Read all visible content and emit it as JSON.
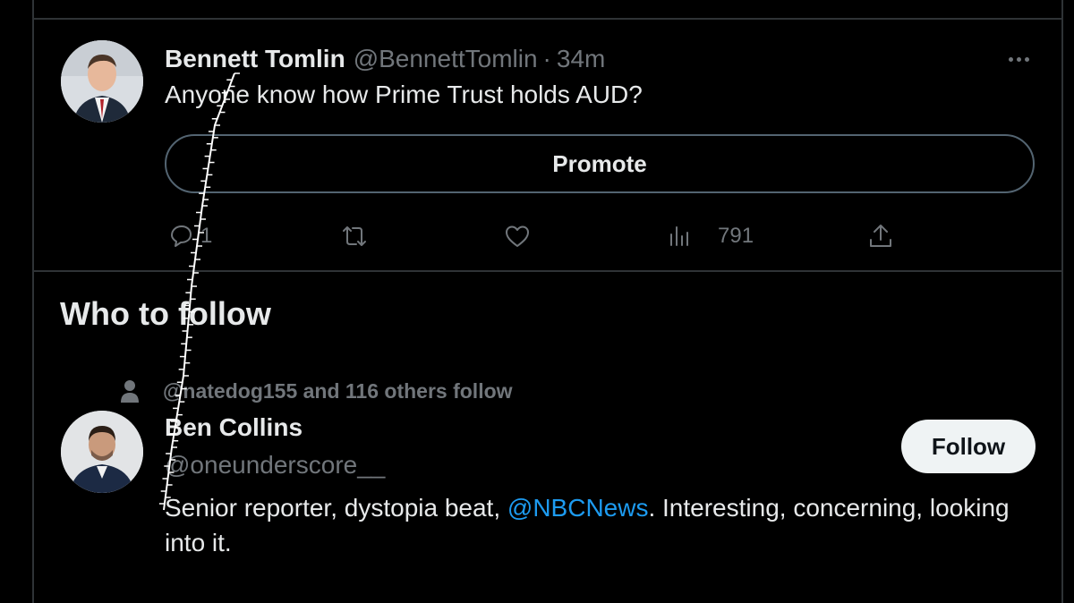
{
  "tweet": {
    "display_name": "Bennett Tomlin",
    "handle": "@BennettTomlin",
    "separator": "·",
    "time": "34m",
    "text": "Anyone know how Prime Trust holds AUD?",
    "promote_label": "Promote",
    "actions": {
      "reply_count": "1",
      "retweet_count": "",
      "like_count": "",
      "views_count": "791"
    },
    "icons": [
      "reply-icon",
      "retweet-icon",
      "like-icon",
      "views-icon",
      "share-icon",
      "more-icon"
    ]
  },
  "who_to_follow": {
    "title": "Who to follow",
    "social_context": "@natedog155 and 116 others follow",
    "user": {
      "name": "Ben Collins",
      "handle": "@oneunderscore__",
      "follow_label": "Follow",
      "bio_before": "Senior reporter, dystopia beat, ",
      "bio_mention": "@NBCNews",
      "bio_after": ". Interesting, concerning, looking into it."
    }
  },
  "colors": {
    "background": "#000000",
    "border": "#2f3336",
    "text": "#e7e9ea",
    "muted": "#71767b",
    "link": "#1d9bf0",
    "follow_bg": "#eff3f4"
  }
}
